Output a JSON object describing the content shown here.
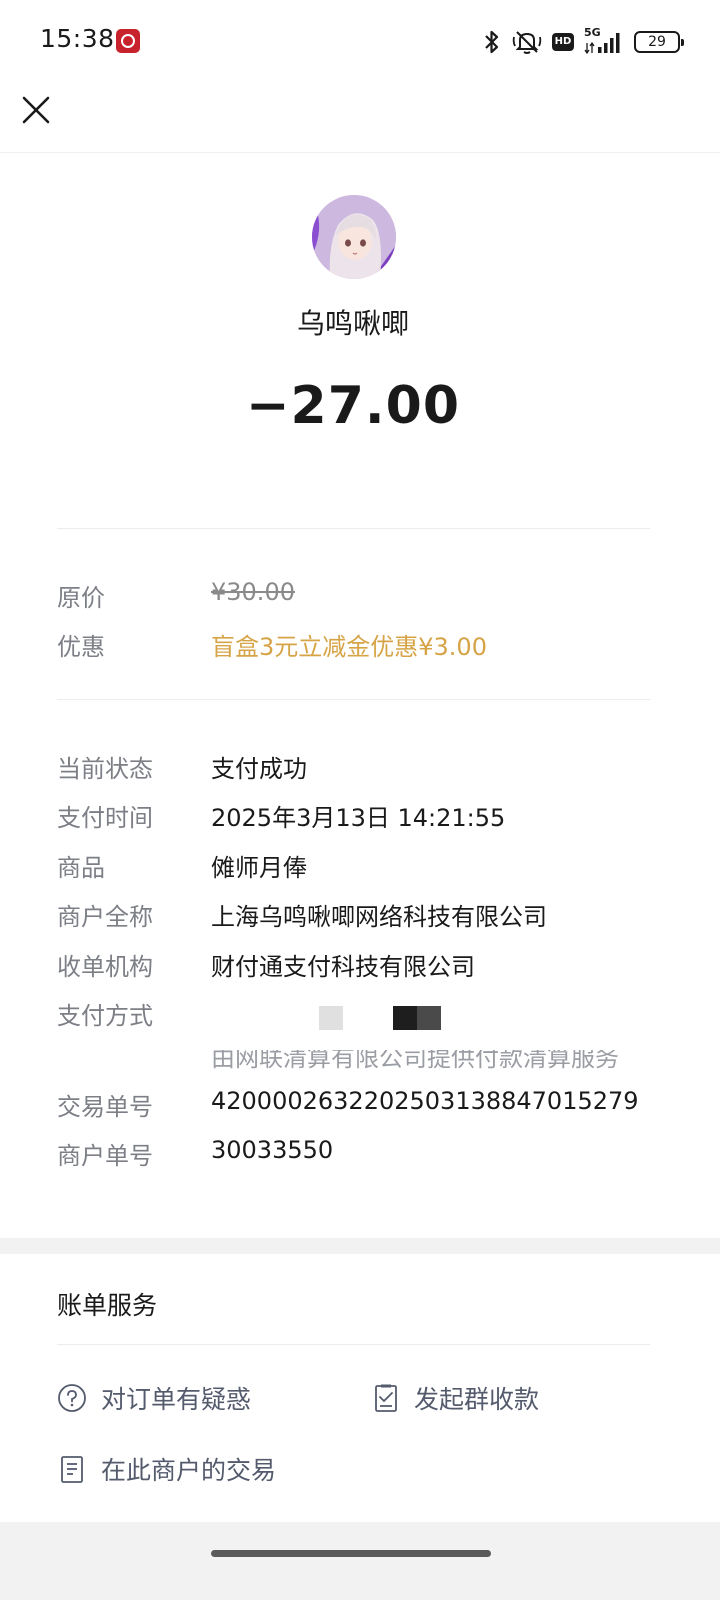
{
  "status_bar": {
    "time": "15:38",
    "network": "5G",
    "hd_label": "HD",
    "battery": "29"
  },
  "header": {
    "close_icon": "close-icon"
  },
  "merchant": {
    "name": "乌鸣啾唧",
    "amount": "−27.00"
  },
  "pricing": {
    "original_price_label": "原价",
    "original_price_value": "¥30.00",
    "discount_label": "优惠",
    "discount_value": "盲盒3元立减金优惠¥3.00"
  },
  "details": {
    "status_label": "当前状态",
    "status_value": "支付成功",
    "pay_time_label": "支付时间",
    "pay_time_value": "2025年3月13日 14:21:55",
    "product_label": "商品",
    "product_value": "傩师月俸",
    "merchant_full_label": "商户全称",
    "merchant_full_value": "上海乌鸣啾唧网络科技有限公司",
    "acquirer_label": "收单机构",
    "acquirer_value": "财付通支付科技有限公司",
    "pay_method_label": "支付方式",
    "pay_method_sub": "由网联清算有限公司提供付款清算服务",
    "trade_no_label": "交易单号",
    "trade_no_value": "4200002632202503138847015279",
    "merchant_no_label": "商户单号",
    "merchant_no_value": "30033550"
  },
  "services": {
    "title": "账单服务",
    "order_question": "对订单有疑惑",
    "group_collect": "发起群收款",
    "merchant_trades": "在此商户的交易"
  },
  "colors": {
    "discount": "#d6a447",
    "label_gray": "#7c7f86",
    "service_text": "#545b6d",
    "band_gray": "#f2f2f2"
  }
}
